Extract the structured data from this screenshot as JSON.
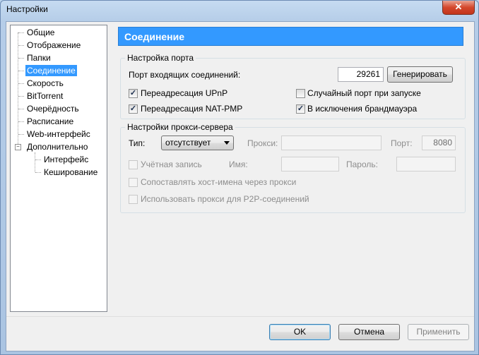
{
  "window": {
    "title": "Настройки",
    "close_label": "✕"
  },
  "sidebar": {
    "items": [
      {
        "label": "Общие"
      },
      {
        "label": "Отображение"
      },
      {
        "label": "Папки"
      },
      {
        "label": "Соединение"
      },
      {
        "label": "Скорость"
      },
      {
        "label": "BitTorrent"
      },
      {
        "label": "Очерёдность"
      },
      {
        "label": "Расписание"
      },
      {
        "label": "Web-интерфейс"
      },
      {
        "label": "Дополнительно"
      },
      {
        "label": "Интерфейс"
      },
      {
        "label": "Кеширование"
      }
    ],
    "selected": "Соединение",
    "expander_symbol": "−"
  },
  "page": {
    "title": "Соединение"
  },
  "port_settings": {
    "title": "Настройка порта",
    "incoming_port_label": "Порт входящих соединений:",
    "incoming_port_value": "29261",
    "generate_label": "Генерировать",
    "upnp_label": "Переадресация UPnP",
    "upnp_checked": true,
    "random_port_label": "Случайный порт при запуске",
    "random_port_checked": false,
    "natpmp_label": "Переадресация NAT-PMP",
    "natpmp_checked": true,
    "firewall_label": "В исключения брандмауэра",
    "firewall_checked": true
  },
  "proxy_settings": {
    "title": "Настройки прокси-сервера",
    "type_label": "Тип:",
    "type_value": "отсутствует",
    "proxy_label": "Прокси:",
    "proxy_value": "",
    "port_label": "Порт:",
    "port_value": "8080",
    "account_label": "Учётная запись",
    "account_checked": false,
    "name_label": "Имя:",
    "name_value": "",
    "password_label": "Пароль:",
    "password_value": "",
    "map_hostnames_label": "Сопоставлять хост-имена через прокси",
    "map_hostnames_checked": false,
    "p2p_label": "Использовать прокси для P2P-соединений",
    "p2p_checked": false
  },
  "footer": {
    "ok_label": "OK",
    "cancel_label": "Отмена",
    "apply_label": "Применить"
  },
  "glyphs": {
    "check": "✓"
  }
}
